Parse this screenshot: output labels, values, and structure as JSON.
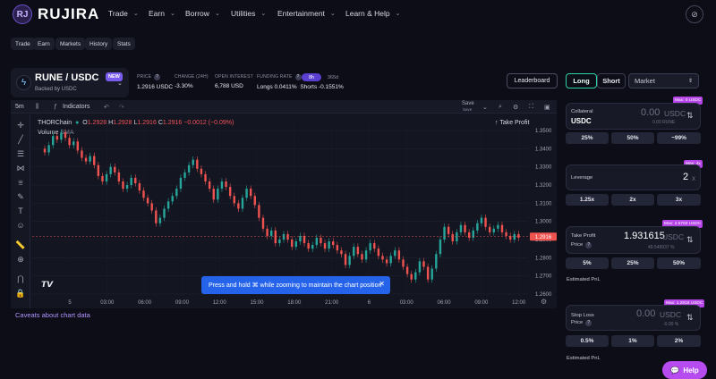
{
  "app": {
    "brand": "RUJIRA",
    "logo_text": "RJ"
  },
  "nav": [
    {
      "label": "Trade"
    },
    {
      "label": "Earn"
    },
    {
      "label": "Borrow"
    },
    {
      "label": "Utilities"
    },
    {
      "label": "Entertainment"
    },
    {
      "label": "Learn & Help"
    }
  ],
  "subtabs": [
    "Trade",
    "Earn",
    "Markets",
    "History",
    "Stats"
  ],
  "market": {
    "pair": "RUNE / USDC",
    "badge": "NEW",
    "backed": "Backed by USDC",
    "stats": [
      {
        "label": "PRICE",
        "value": "1.2916 USDC"
      },
      {
        "label": "CHANGE (24H)",
        "value": "-3.30%"
      },
      {
        "label": "OPEN INTEREST",
        "value": "6,788 USD"
      },
      {
        "label": "FUNDING RATE",
        "value": "Longs 0.0411%"
      }
    ],
    "funding_shorts": "Shorts -0.1551%",
    "funding_periods": [
      "8h",
      "365d"
    ],
    "leaderboard": "Leaderboard"
  },
  "chart_toolbar": {
    "interval": "5m",
    "indicators": "Indicators",
    "save": "Save",
    "save_sub": "Save"
  },
  "chart_header": {
    "source": "THORChain",
    "o_label": "O",
    "o": "1.2928",
    "h_label": "H",
    "h": "1.2928",
    "l_label": "L",
    "l": "1.2916",
    "c_label": "C",
    "c": "1.2916",
    "chg": "−0.0012 (−0.09%)",
    "volume": "Volume",
    "sma": "SMA",
    "take_profit": "Take Profit",
    "current_price": "1.2916"
  },
  "chart_data": {
    "type": "line",
    "x_ticks": [
      "5",
      "03:00",
      "06:00",
      "09:00",
      "12:00",
      "15:00",
      "18:00",
      "21:00",
      "6",
      "03:00",
      "06:00",
      "09:00",
      "12:00"
    ],
    "y_ticks": [
      "1.3500",
      "1.3400",
      "1.3300",
      "1.3200",
      "1.3100",
      "1.3000",
      "1.2900",
      "1.2800",
      "1.2700",
      "1.2600"
    ],
    "ylim": [
      1.2585,
      1.3535
    ],
    "current_price": 1.2916,
    "series": [
      {
        "values": [
          1.338,
          1.342,
          1.347,
          1.345,
          1.349,
          1.346,
          1.342,
          1.344,
          1.339,
          1.335,
          1.333,
          1.336,
          1.331,
          1.325,
          1.322,
          1.326,
          1.33,
          1.327,
          1.322,
          1.318,
          1.32,
          1.324,
          1.321,
          1.317,
          1.313,
          1.31,
          1.306,
          1.299,
          1.302,
          1.307,
          1.311,
          1.314,
          1.318,
          1.324,
          1.327,
          1.331,
          1.334,
          1.329,
          1.326,
          1.322,
          1.318,
          1.312,
          1.318,
          1.322,
          1.319,
          1.314,
          1.31,
          1.307,
          1.313,
          1.318,
          1.314,
          1.309,
          1.302,
          1.296,
          1.292,
          1.295,
          1.288,
          1.29,
          1.293,
          1.29,
          1.286,
          1.289,
          1.292,
          1.288,
          1.285,
          1.287,
          1.291,
          1.288,
          1.285,
          1.289,
          1.287,
          1.284,
          1.282,
          1.276,
          1.281,
          1.286,
          1.282,
          1.279,
          1.284,
          1.288,
          1.285,
          1.281,
          1.279,
          1.277,
          1.281,
          1.284,
          1.279,
          1.275,
          1.271,
          1.268,
          1.272,
          1.278,
          1.275,
          1.268,
          1.274,
          1.282,
          1.29,
          1.297,
          1.293,
          1.289,
          1.294,
          1.298,
          1.294,
          1.291,
          1.295,
          1.299,
          1.302,
          1.297,
          1.294,
          1.296,
          1.298,
          1.294,
          1.292,
          1.29,
          1.293,
          1.291
        ]
      }
    ]
  },
  "toast": "Press and hold ⌘ while zooming to maintain the chart position",
  "caveats": "Caveats about chart data",
  "order": {
    "long": "Long",
    "short": "Short",
    "type": "Market",
    "collateral": {
      "max": "Max: 0 USDC",
      "label": "Collateral",
      "token": "USDC",
      "value": "0.00",
      "unit": "USDC",
      "sub": "0.00 RUNE",
      "options": [
        "25%",
        "50%",
        "~99%"
      ]
    },
    "leverage": {
      "max": "Max: 4x",
      "label": "Leverage",
      "value": "2",
      "unit": "x",
      "options": [
        "1.25x",
        "2x",
        "3x"
      ]
    },
    "take_profit": {
      "max": "Max: 2.5783 USDC",
      "label1": "Take Profit",
      "label2": "Price",
      "value": "1.931615",
      "unit": "USDC",
      "sub": "49.549937 %",
      "options": [
        "5%",
        "25%",
        "50%"
      ],
      "pnl": "Estimated PnL"
    },
    "stop_loss": {
      "max": "Max: 1.2916 USDC",
      "label1": "Stop Loss",
      "label2": "Price",
      "value": "0.00",
      "unit": "USDC",
      "sub": "-0.00 %",
      "options": [
        "0.5%",
        "1%",
        "2%"
      ],
      "pnl": "Estimated PnL"
    }
  },
  "help": "Help",
  "colors": {
    "accent": "#7b5cf0",
    "up": "#26a69a",
    "down": "#ef5350",
    "long_border": "#2fd0a8",
    "max_badge": "#b545e6"
  }
}
